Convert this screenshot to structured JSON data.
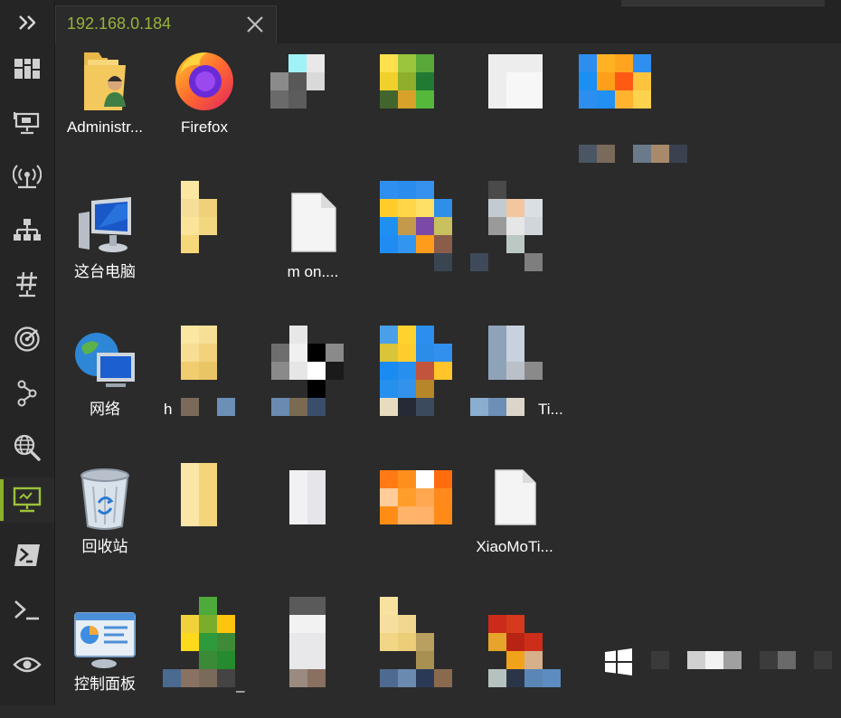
{
  "tab": {
    "title": "192.168.0.184"
  },
  "rail": {
    "items": [
      {
        "name": "dashboard-icon"
      },
      {
        "name": "remote-desktop-icon"
      },
      {
        "name": "wireless-icon"
      },
      {
        "name": "network-icon"
      },
      {
        "name": "hash-icon"
      },
      {
        "name": "radar-icon"
      },
      {
        "name": "share-nodes-icon"
      },
      {
        "name": "web-search-icon"
      },
      {
        "name": "remote-screen-icon",
        "active": true
      },
      {
        "name": "powershell-icon"
      },
      {
        "name": "terminal-icon"
      },
      {
        "name": "eye-icon"
      }
    ]
  },
  "desktop": {
    "icons": [
      {
        "label": "Administr...",
        "icon": "user-folder-icon"
      },
      {
        "label": "Firefox",
        "icon": "firefox-icon"
      },
      {
        "label": "这台电脑",
        "icon": "this-pc-icon"
      },
      {
        "label": "m       on....",
        "icon": "blank-file-icon"
      },
      {
        "label": "网络",
        "icon": "network-globe-icon"
      },
      {
        "label": "h",
        "icon": "pixelated-icon"
      },
      {
        "label": "Ti...",
        "icon": "pixelated-icon"
      },
      {
        "label": "回收站",
        "icon": "recycle-bin-icon"
      },
      {
        "label": "XiaoMoTi...",
        "icon": "blank-file-icon"
      },
      {
        "label": "控制面板",
        "icon": "control-panel-icon"
      },
      {
        "label": "_",
        "icon": "pixelated-icon"
      }
    ]
  },
  "colors": {
    "accent": "#8ab12a",
    "tab_text": "#97b33b",
    "rail_bg": "#252525",
    "desktop_bg": "#2b2b2b"
  }
}
